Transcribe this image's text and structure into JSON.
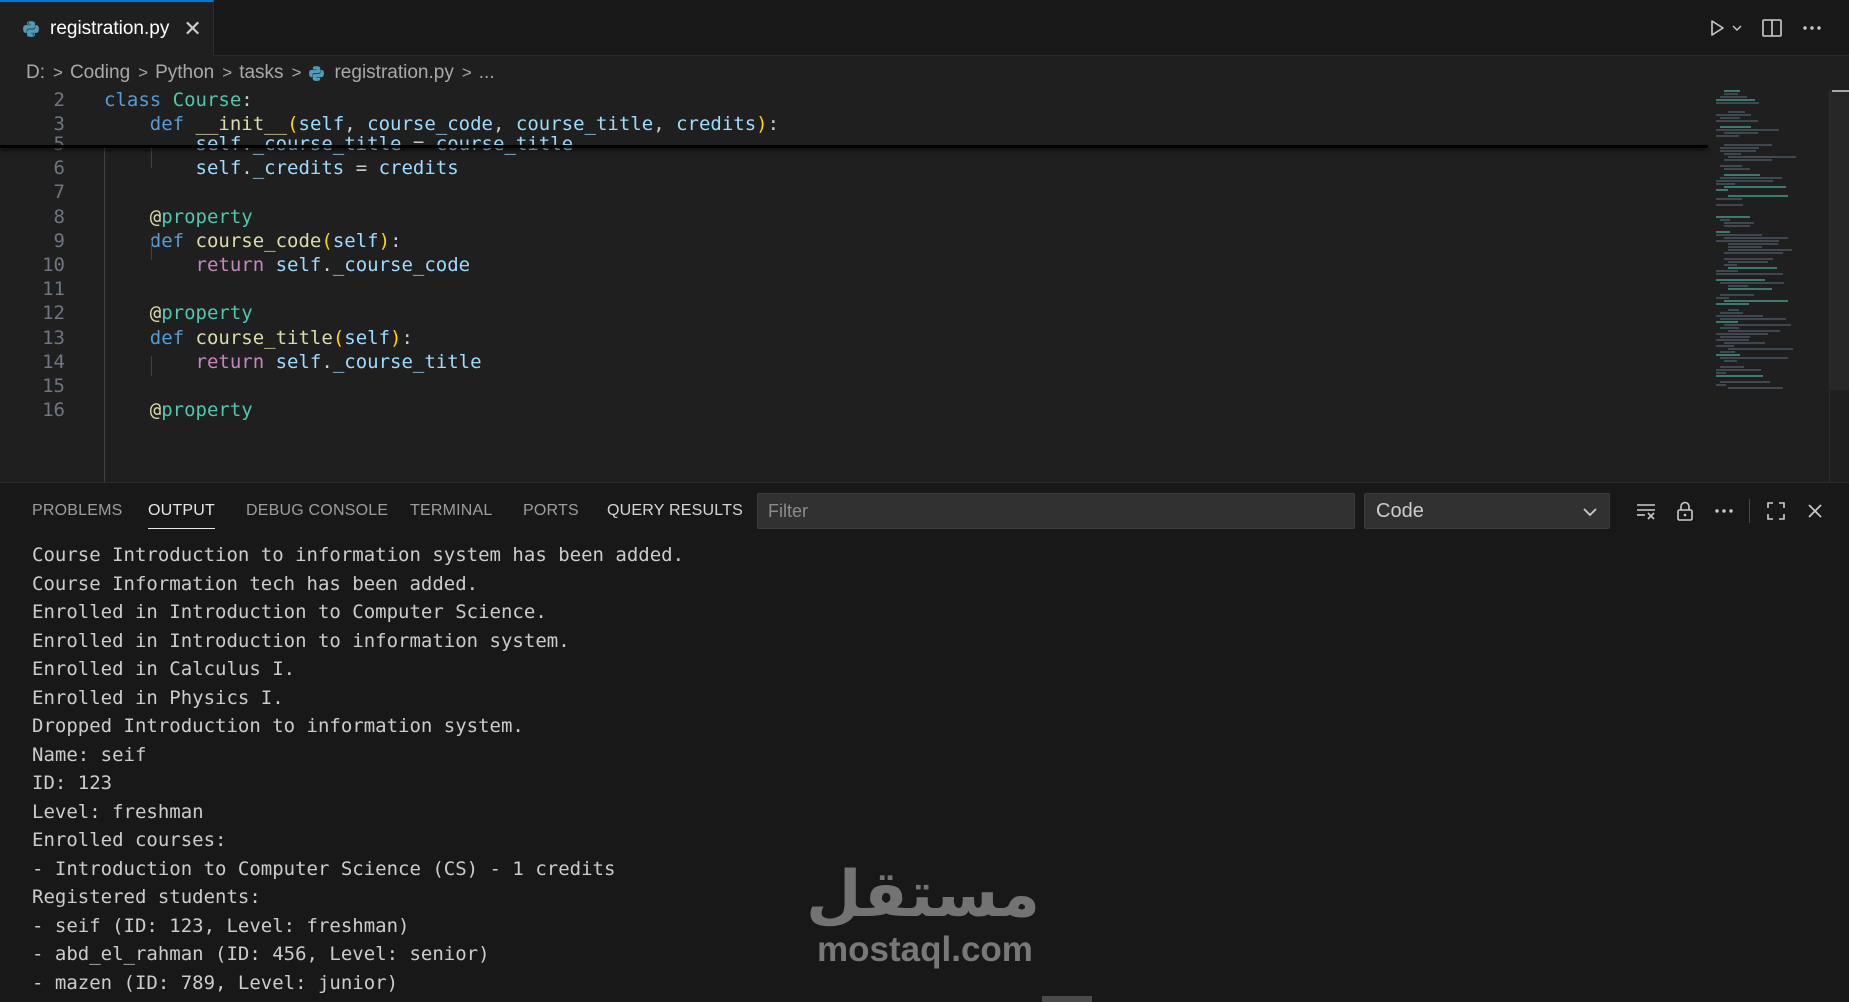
{
  "tab": {
    "label": "registration.py",
    "close": "✕"
  },
  "breadcrumb": {
    "items": [
      "D:",
      "Coding",
      "Python",
      "tasks",
      "registration.py",
      "..."
    ]
  },
  "editor": {
    "sticky_lines": [
      {
        "num": "2",
        "tokens": [
          [
            "kw",
            "class"
          ],
          [
            "plain",
            " "
          ],
          [
            "cls",
            "Course"
          ],
          [
            "plain",
            ":"
          ]
        ]
      },
      {
        "num": "3",
        "tokens": [
          [
            "plain",
            "    "
          ],
          [
            "kw",
            "def"
          ],
          [
            "plain",
            " "
          ],
          [
            "fn",
            "__init__"
          ],
          [
            "brk",
            "("
          ],
          [
            "param",
            "self"
          ],
          [
            "plain",
            ", "
          ],
          [
            "param",
            "course_code"
          ],
          [
            "plain",
            ", "
          ],
          [
            "param",
            "course_title"
          ],
          [
            "plain",
            ", "
          ],
          [
            "param",
            "credits"
          ],
          [
            "brk",
            ")"
          ],
          [
            "plain",
            ":"
          ]
        ]
      }
    ],
    "lines": [
      {
        "num": "5",
        "tokens": [
          [
            "plain",
            "        "
          ],
          [
            "param",
            "self"
          ],
          [
            "plain",
            "."
          ],
          [
            "param",
            "_course_title"
          ],
          [
            "plain",
            " = "
          ],
          [
            "param",
            "course_title"
          ]
        ]
      },
      {
        "num": "6",
        "tokens": [
          [
            "plain",
            "        "
          ],
          [
            "param",
            "self"
          ],
          [
            "plain",
            "."
          ],
          [
            "param",
            "_credits"
          ],
          [
            "plain",
            " = "
          ],
          [
            "param",
            "credits"
          ]
        ]
      },
      {
        "num": "7",
        "tokens": []
      },
      {
        "num": "8",
        "tokens": [
          [
            "plain",
            "    "
          ],
          [
            "dec",
            "@"
          ],
          [
            "cls",
            "property"
          ]
        ]
      },
      {
        "num": "9",
        "tokens": [
          [
            "plain",
            "    "
          ],
          [
            "kw",
            "def"
          ],
          [
            "plain",
            " "
          ],
          [
            "fn",
            "course_code"
          ],
          [
            "brk",
            "("
          ],
          [
            "param",
            "self"
          ],
          [
            "brk",
            ")"
          ],
          [
            "plain",
            ":"
          ]
        ]
      },
      {
        "num": "10",
        "tokens": [
          [
            "plain",
            "        "
          ],
          [
            "ret",
            "return"
          ],
          [
            "plain",
            " "
          ],
          [
            "param",
            "self"
          ],
          [
            "plain",
            "."
          ],
          [
            "param",
            "_course_code"
          ]
        ]
      },
      {
        "num": "11",
        "tokens": []
      },
      {
        "num": "12",
        "tokens": [
          [
            "plain",
            "    "
          ],
          [
            "dec",
            "@"
          ],
          [
            "cls",
            "property"
          ]
        ]
      },
      {
        "num": "13",
        "tokens": [
          [
            "plain",
            "    "
          ],
          [
            "kw",
            "def"
          ],
          [
            "plain",
            " "
          ],
          [
            "fn",
            "course_title"
          ],
          [
            "brk",
            "("
          ],
          [
            "param",
            "self"
          ],
          [
            "brk",
            ")"
          ],
          [
            "plain",
            ":"
          ]
        ]
      },
      {
        "num": "14",
        "tokens": [
          [
            "plain",
            "        "
          ],
          [
            "ret",
            "return"
          ],
          [
            "plain",
            " "
          ],
          [
            "param",
            "self"
          ],
          [
            "plain",
            "."
          ],
          [
            "param",
            "_course_title"
          ]
        ]
      },
      {
        "num": "15",
        "tokens": []
      },
      {
        "num": "16",
        "tokens": [
          [
            "plain",
            "    "
          ],
          [
            "dec",
            "@"
          ],
          [
            "cls",
            "property"
          ]
        ]
      }
    ]
  },
  "panel": {
    "tabs": [
      "PROBLEMS",
      "OUTPUT",
      "DEBUG CONSOLE",
      "TERMINAL",
      "PORTS",
      "QUERY RESULTS"
    ],
    "active_tab": "OUTPUT",
    "filter_placeholder": "Filter",
    "channel": "Code",
    "output_lines": [
      "Course Introduction to information system has been added.",
      "Course Information tech has been added.",
      "Enrolled in Introduction to Computer Science.",
      "Enrolled in Introduction to information system.",
      "Enrolled in Calculus I.",
      "Enrolled in Physics I.",
      "Dropped Introduction to information system.",
      "Name: seif",
      "ID: 123",
      "Level: freshman",
      "Enrolled courses:",
      "- Introduction to Computer Science (CS) - 1 credits",
      "Registered students:",
      "- seif (ID: 123, Level: freshman)",
      "- abd_el_rahman (ID: 456, Level: senior)",
      "- mazen (ID: 789, Level: junior)"
    ]
  },
  "watermark": {
    "logo": "مستقل",
    "url": "mostaql.com"
  },
  "colors": {
    "accent": "#0078d4",
    "keyword": "#569cd6",
    "class": "#4ec9b0",
    "function": "#dcdcaa",
    "parameter": "#9cdcfe",
    "control": "#c586c0",
    "bracket": "#ffd700"
  }
}
